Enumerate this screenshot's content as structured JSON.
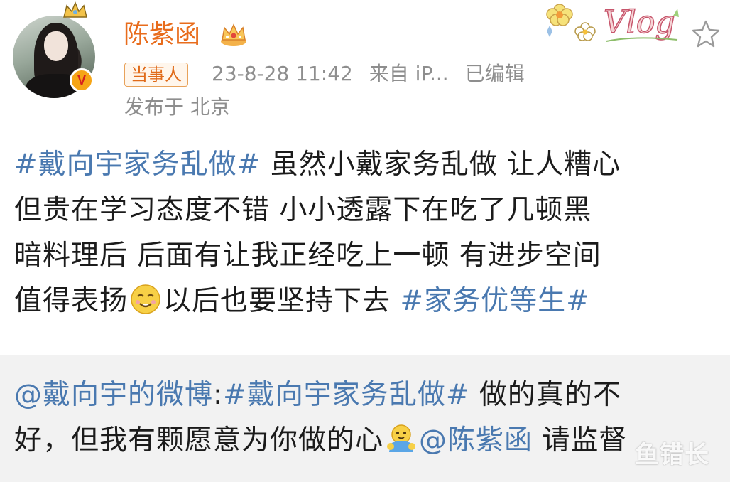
{
  "author": {
    "name": "陈紫函",
    "role_tag": "当事人",
    "timestamp": "23-8-28 11:42",
    "source": "来自 iP...",
    "edited": "已编辑",
    "location": "发布于 北京"
  },
  "post": {
    "topic_1": "#戴向宇家务乱做#",
    "line_1": " 虽然小戴家务乱做 让人糟心",
    "line_2": "但贵在学习态度不错 小小透露下在吃了几顿黑",
    "line_3": "暗料理后 后面有让我正经吃上一顿 有进步空间",
    "line_4a": "值得表扬",
    "line_4b": "以后也要坚持下去 ",
    "topic_2": "#家务优等生#"
  },
  "repost": {
    "mention_1": "@戴向宇的微博",
    "colon": ":",
    "topic": "#戴向宇家务乱做#",
    "text_1": " 做的真的不",
    "text_2": "好，但我有颗愿意为你做的心",
    "mention_2": "@陈紫函",
    "text_3": " 请监督"
  },
  "watermark": "鱼错长",
  "colors": {
    "username": "#e86c1c",
    "topic_link": "#4a79b0",
    "meta_gray": "#8e8e8e",
    "repost_bg": "#f2f2f2"
  },
  "icons": {
    "vip": "crown-icon",
    "verified": "verified-v-icon",
    "favorite": "star-icon",
    "emoji_1": "grin-emoji-icon",
    "emoji_2": "hug-emoji-icon"
  }
}
